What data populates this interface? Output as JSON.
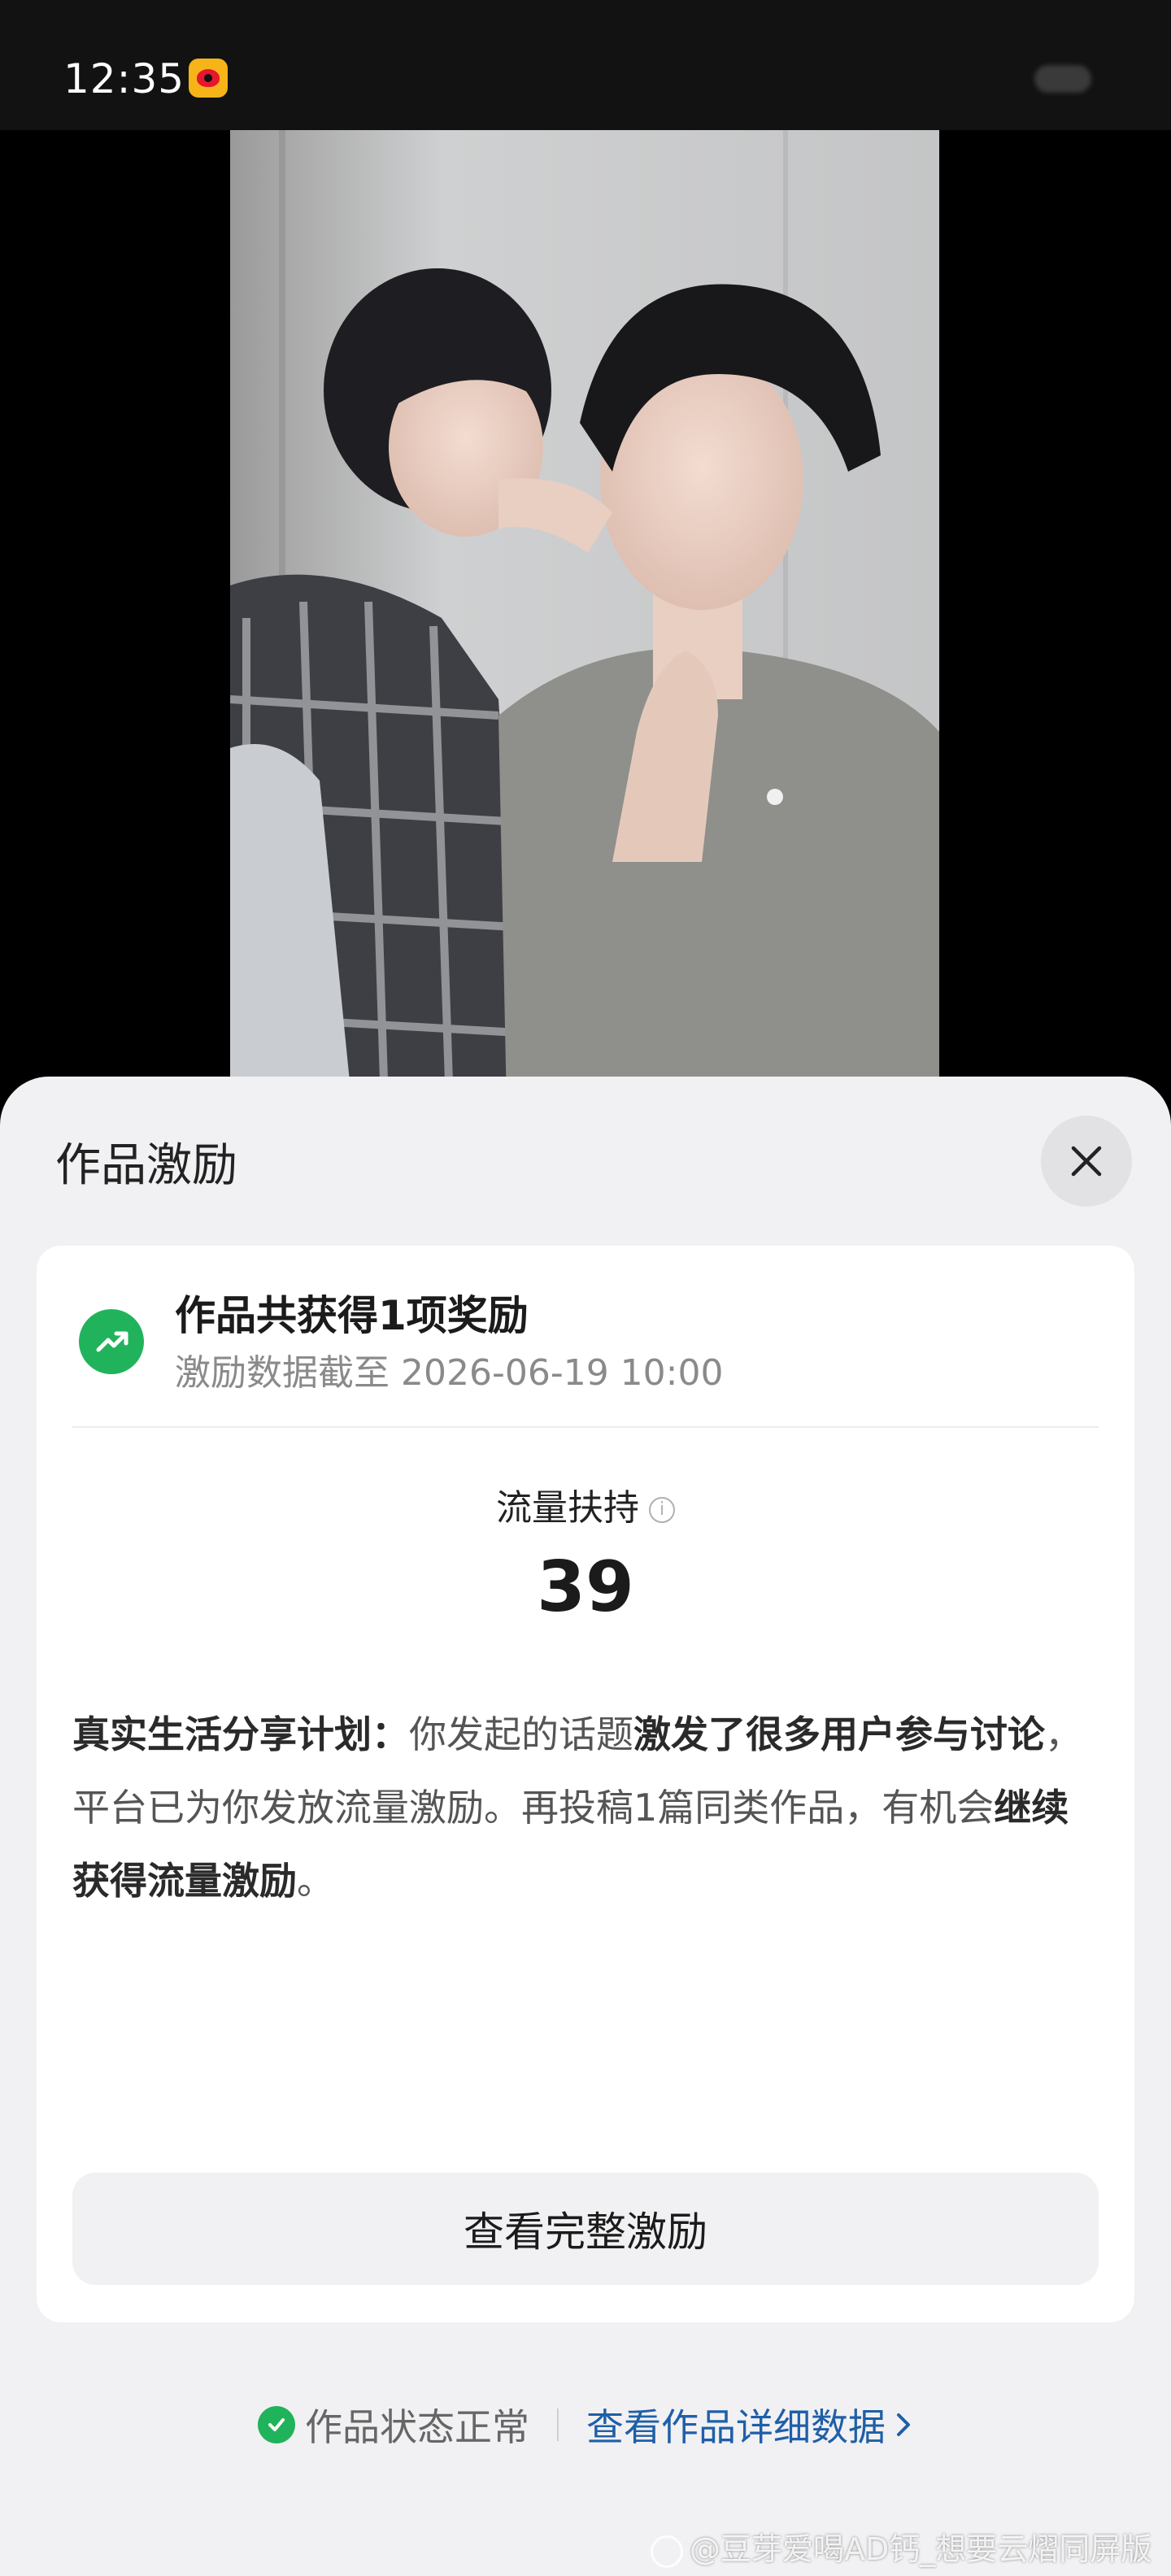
{
  "status_bar": {
    "time": "12:35",
    "app_icon": "weibo-icon"
  },
  "media": {
    "description_icon": "photo"
  },
  "sheet": {
    "title": "作品激励",
    "close_icon": "close-icon",
    "reward_card": {
      "icon": "trending-up-icon",
      "title": "作品共获得1项奖励",
      "subtitle": "激励数据截至 2026-06-19 10:00",
      "metric_label": "流量扶持",
      "metric_info_icon": "info-icon",
      "metric_value": "39",
      "plan": {
        "part1_bold": "真实生活分享计划：",
        "part2": "你发起的话题",
        "part3_bold": "激发了很多用户参与讨论",
        "part4": "，平台已为你发放流量激励。再投稿1篇同类作品，有机会",
        "part5_bold": "继续获得流量激励",
        "part6": "。"
      },
      "button_label": "查看完整激励"
    },
    "footer": {
      "status_text": "作品状态正常",
      "link_text": "查看作品详细数据"
    }
  },
  "watermark": "@豆芽爱喝AD钙_想要云熠同屏版",
  "colors": {
    "accent_green": "#21b35b",
    "link_blue": "#1f5fa8",
    "sheet_bg": "#f1f1f3"
  }
}
